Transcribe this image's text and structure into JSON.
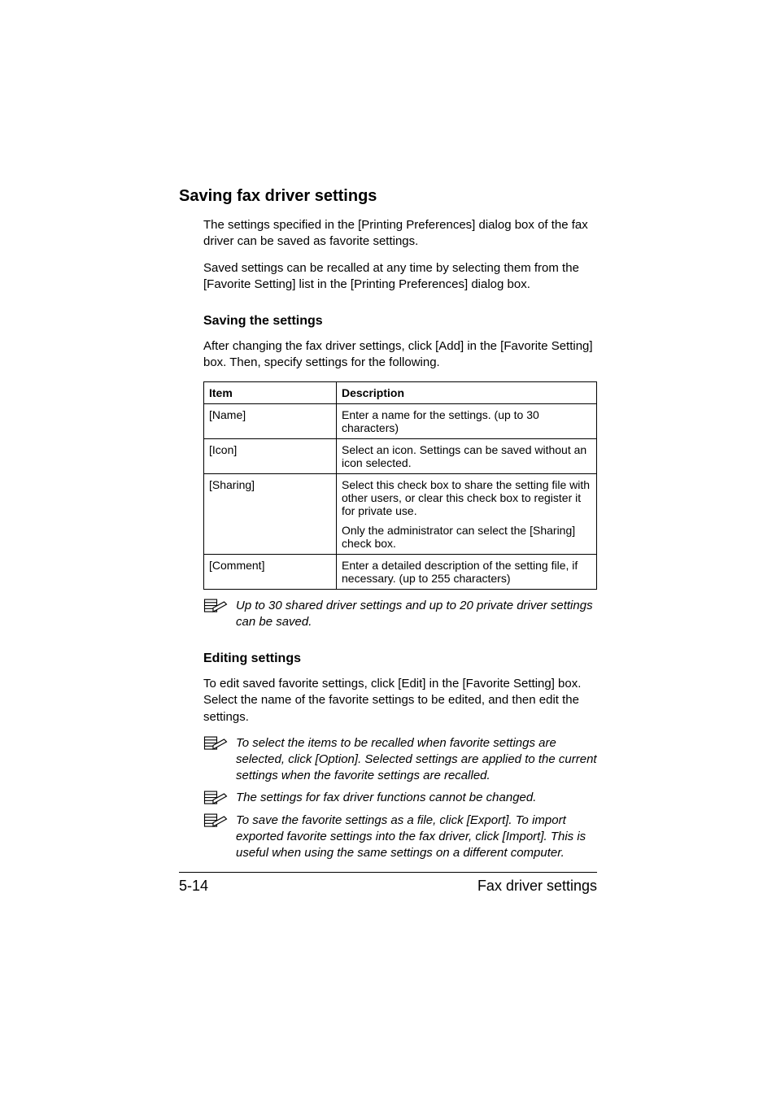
{
  "heading": "Saving fax driver settings",
  "intro_para_1": "The settings specified in the [Printing Preferences] dialog box of the fax driver can be saved as favorite settings.",
  "intro_para_2": "Saved settings can be recalled at any time by selecting them from the [Favorite Setting] list in the [Printing Preferences] dialog box.",
  "saving_heading": "Saving the settings",
  "saving_para": "After changing the fax driver settings, click [Add] in the [Favorite Setting] box. Then, specify settings for the following.",
  "table_header_item": "Item",
  "table_header_desc": "Description",
  "rows": {
    "name_item": "[Name]",
    "name_desc": "Enter a name for the settings. (up to 30 characters)",
    "icon_item": "[Icon]",
    "icon_desc": "Select an icon. Settings can be saved without an icon selected.",
    "sharing_item": "[Sharing]",
    "sharing_desc_1": "Select this check box to share the setting file with other users, or clear this check box to register it for private use.",
    "sharing_desc_2": "Only the administrator can select the [Sharing] check box.",
    "comment_item": "[Comment]",
    "comment_desc": "Enter a detailed description of the setting file, if necessary. (up to 255 characters)"
  },
  "note_limit": "Up to 30 shared driver settings and up to 20 private driver settings can be saved.",
  "editing_heading": "Editing settings",
  "editing_para": "To edit saved favorite settings, click [Edit] in the [Favorite Setting] box. Select the name of the favorite settings to be edited, and then edit the settings.",
  "note_recall": "To select the items to be recalled when favorite settings are selected, click [Option]. Selected settings are applied to the current settings when the favorite settings are recalled.",
  "note_cannot_change": "The settings for fax driver functions cannot be changed.",
  "note_export": "To save the favorite settings as a file, click [Export]. To import exported favorite settings into the fax driver, click [Import]. This is useful when using the same settings on a different computer.",
  "footer_page": "5-14",
  "footer_title": "Fax driver settings"
}
